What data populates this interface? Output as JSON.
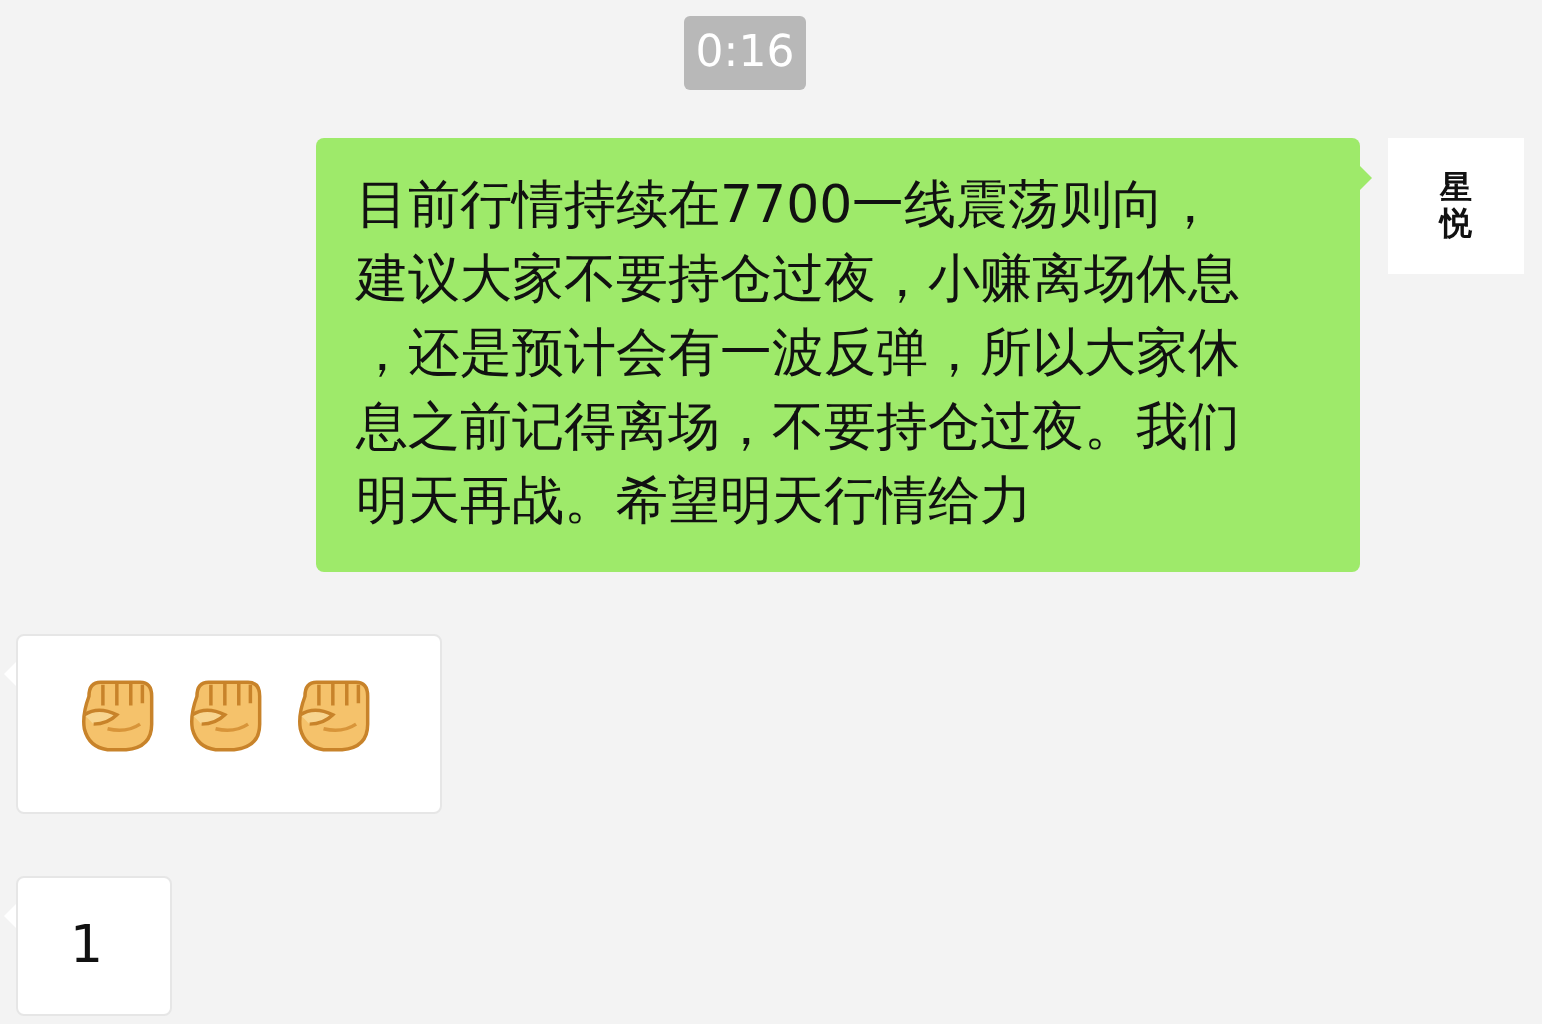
{
  "timestamp": "0:16",
  "messages": [
    {
      "kind": "text",
      "outgoing": true,
      "lines": [
        "目前行情持续在7700一线震荡则向，",
        "建议大家不要持仓过夜，小赚离场休息",
        "，还是预计会有一波反弹，所以大家休",
        "息之前记得离场，不要持仓过夜。我们",
        "明天再战。希望明天行情给力"
      ],
      "avatar_text": "星悦"
    },
    {
      "kind": "emoji",
      "outgoing": false,
      "emojis": [
        {
          "kind": "fist"
        },
        {
          "kind": "fist"
        },
        {
          "kind": "fist"
        }
      ]
    },
    {
      "kind": "text",
      "outgoing": false,
      "lines": [
        "1"
      ]
    }
  ]
}
